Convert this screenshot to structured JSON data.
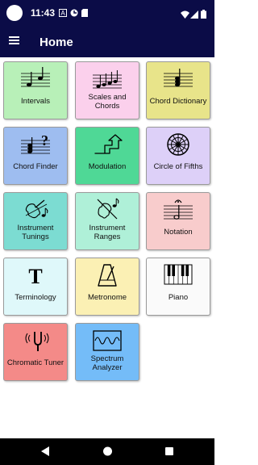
{
  "status_bar": {
    "time": "11:43",
    "icons": [
      "avatar-icon",
      "a-notification-icon",
      "data-saver-icon",
      "sd-card-icon",
      "wifi-icon",
      "signal-icon",
      "battery-icon"
    ]
  },
  "app_bar": {
    "title": "Home",
    "menu_icon": "hamburger-menu-icon"
  },
  "tiles": [
    {
      "label": "Intervals",
      "icon": "intervals-icon",
      "color": "#b8f0b8"
    },
    {
      "label": "Scales and Chords",
      "icon": "scales-icon",
      "color": "#fbd0ec"
    },
    {
      "label": "Chord Dictionary",
      "icon": "chord-dictionary-icon",
      "color": "#e8e48a"
    },
    {
      "label": "Chord Finder",
      "icon": "chord-finder-icon",
      "color": "#9ebdf0"
    },
    {
      "label": "Modulation",
      "icon": "modulation-icon",
      "color": "#4fd896"
    },
    {
      "label": "Circle of Fifths",
      "icon": "circle-of-fifths-icon",
      "color": "#ddd0f8"
    },
    {
      "label": "Instrument Tunings",
      "icon": "instrument-tunings-icon",
      "color": "#7cdcd2"
    },
    {
      "label": "Instrument Ranges",
      "icon": "instrument-ranges-icon",
      "color": "#aff0d8"
    },
    {
      "label": "Notation",
      "icon": "notation-icon",
      "color": "#f8cccc"
    },
    {
      "label": "Terminology",
      "icon": "terminology-icon",
      "color": "#dff8fa"
    },
    {
      "label": "Metronome",
      "icon": "metronome-icon",
      "color": "#fbf0b4"
    },
    {
      "label": "Piano",
      "icon": "piano-icon",
      "color": "#fafafa"
    },
    {
      "label": "Chromatic Tuner",
      "icon": "tuning-fork-icon",
      "color": "#f48a88"
    },
    {
      "label": "Spectrum Analyzer",
      "icon": "spectrum-analyzer-icon",
      "color": "#74bcf8"
    }
  ],
  "nav_bar": {
    "back_icon": "back-icon",
    "home_icon": "home-icon",
    "recents_icon": "recents-icon"
  }
}
